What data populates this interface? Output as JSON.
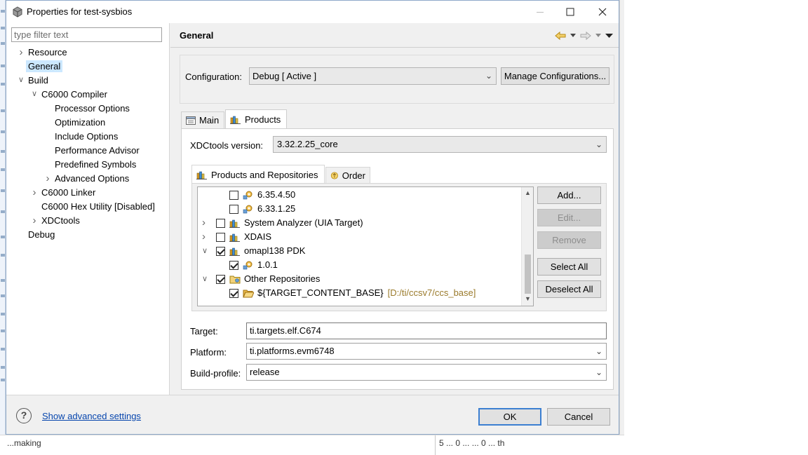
{
  "window": {
    "title": "Properties for test-sysbios"
  },
  "left": {
    "filter_placeholder": "type filter text",
    "tree": [
      {
        "label": "Resource",
        "indent": 0,
        "expander": "collapsed"
      },
      {
        "label": "General",
        "indent": 0,
        "expander": "none",
        "selected": true
      },
      {
        "label": "Build",
        "indent": 0,
        "expander": "expanded"
      },
      {
        "label": "C6000 Compiler",
        "indent": 1,
        "expander": "expanded"
      },
      {
        "label": "Processor Options",
        "indent": 2,
        "expander": "none"
      },
      {
        "label": "Optimization",
        "indent": 2,
        "expander": "none"
      },
      {
        "label": "Include Options",
        "indent": 2,
        "expander": "none"
      },
      {
        "label": "Performance Advisor",
        "indent": 2,
        "expander": "none"
      },
      {
        "label": "Predefined Symbols",
        "indent": 2,
        "expander": "none"
      },
      {
        "label": "Advanced Options",
        "indent": 2,
        "expander": "collapsed"
      },
      {
        "label": "C6000 Linker",
        "indent": 1,
        "expander": "collapsed"
      },
      {
        "label": "C6000 Hex Utility  [Disabled]",
        "indent": 1,
        "expander": "none"
      },
      {
        "label": "XDCtools",
        "indent": 1,
        "expander": "collapsed"
      },
      {
        "label": "Debug",
        "indent": 0,
        "expander": "none"
      }
    ]
  },
  "page": {
    "title": "General",
    "configuration_label": "Configuration:",
    "configuration_value": "Debug  [ Active ]",
    "manage_button": "Manage Configurations...",
    "tabs": [
      {
        "label": "Main",
        "active": false
      },
      {
        "label": "Products",
        "active": true
      }
    ],
    "xdc_label": "XDCtools version:",
    "xdc_value": "3.32.2.25_core",
    "subtabs": [
      {
        "label": "Products and Repositories",
        "active": true
      },
      {
        "label": "Order",
        "active": false
      }
    ],
    "repos": [
      {
        "label": "6.35.4.50",
        "level": 1,
        "checked": false,
        "expander": "none",
        "icon": "version-gear-icon"
      },
      {
        "label": "6.33.1.25",
        "level": 1,
        "checked": false,
        "expander": "none",
        "icon": "version-gear-icon"
      },
      {
        "label": "System Analyzer (UIA Target)",
        "level": 0,
        "checked": false,
        "expander": "collapsed",
        "icon": "product-books-icon"
      },
      {
        "label": "XDAIS",
        "level": 0,
        "checked": false,
        "expander": "collapsed",
        "icon": "product-books-icon"
      },
      {
        "label": "omapl138 PDK",
        "level": 0,
        "checked": true,
        "expander": "expanded",
        "icon": "product-books-icon"
      },
      {
        "label": "1.0.1",
        "level": 1,
        "checked": true,
        "expander": "none",
        "icon": "version-gear-icon"
      },
      {
        "label": "Other Repositories",
        "level": 0,
        "checked": true,
        "expander": "expanded",
        "icon": "repository-folder-icon"
      },
      {
        "label": "${TARGET_CONTENT_BASE}",
        "path": "[D:/ti/ccsv7/ccs_base]",
        "level": 1,
        "checked": true,
        "expander": "none",
        "icon": "open-folder-icon"
      }
    ],
    "side_buttons": [
      {
        "label": "Add...",
        "enabled": true
      },
      {
        "label": "Edit...",
        "enabled": false
      },
      {
        "label": "Remove",
        "enabled": false
      },
      {
        "label": "Select All",
        "enabled": true
      },
      {
        "label": "Deselect All",
        "enabled": true
      }
    ],
    "target_label": "Target:",
    "target_value": "ti.targets.elf.C674",
    "platform_label": "Platform:",
    "platform_value": "ti.platforms.evm6748",
    "profile_label": "Build-profile:",
    "profile_value": "release"
  },
  "footer": {
    "advanced_link": "Show advanced settings",
    "ok": "OK",
    "cancel": "Cancel"
  },
  "background": {
    "bottom_left_text": "...making",
    "bottom_right_text": "5 ... 0 ... ... 0 ... th"
  },
  "colors": {
    "accent": "#3c7fd1",
    "selection": "#cce8ff",
    "link": "#0645ad"
  }
}
